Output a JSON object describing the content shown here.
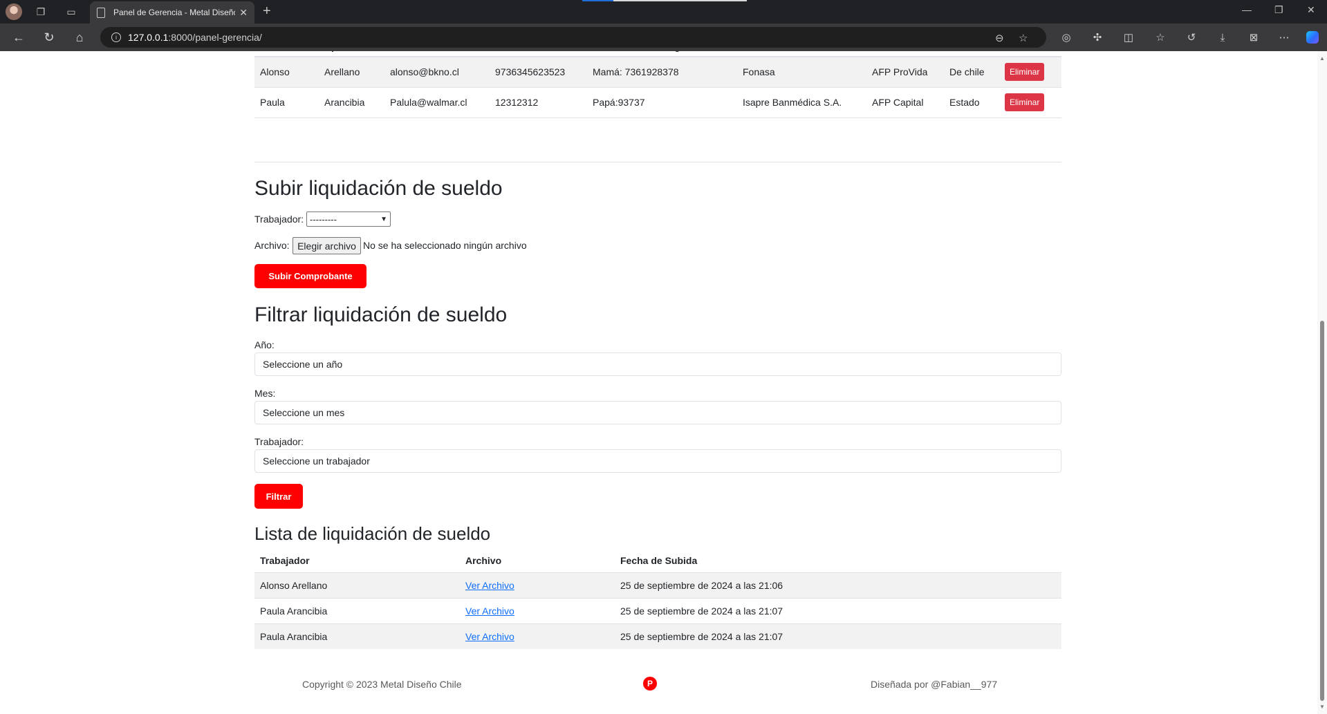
{
  "browser": {
    "tab_title": "Panel de Gerencia - Metal Diseño",
    "tab_close": "✕",
    "new_tab": "+",
    "url_host": "127.0.0.1",
    "url_rest": ":8000/panel-gerencia/"
  },
  "workers_table": {
    "headers": [
      "Nombres",
      "Apellidos",
      "Correo",
      "Teléfono",
      "Contacto de emergencia",
      "Afiliación",
      "AFP",
      "Banco",
      "Acciones"
    ],
    "rows": [
      [
        "Alonso",
        "Arellano",
        "alonso@bkno.cl",
        "9736345623523",
        "Mamá: 7361928378",
        "Fonasa",
        "AFP ProVida",
        "De chile"
      ],
      [
        "Paula",
        "Arancibia",
        "Palula@walmar.cl",
        "12312312",
        "Papá:93737",
        "Isapre Banmédica S.A.",
        "AFP Capital",
        "Estado"
      ]
    ],
    "delete_label": "Eliminar"
  },
  "upload": {
    "title": "Subir liquidación de sueldo",
    "worker_label": "Trabajador:",
    "worker_select_value": "---------",
    "file_label": "Archivo:",
    "file_button": "Elegir archivo",
    "file_status": "No se ha seleccionado ningún archivo",
    "submit": "Subir Comprobante"
  },
  "filter": {
    "title": "Filtrar liquidación de sueldo",
    "year_label": "Año:",
    "year_value": "Seleccione un año",
    "month_label": "Mes:",
    "month_value": "Seleccione un mes",
    "worker_label": "Trabajador:",
    "worker_value": "Seleccione un trabajador",
    "submit": "Filtrar"
  },
  "list": {
    "title": "Lista de liquidación de sueldo",
    "headers": [
      "Trabajador",
      "Archivo",
      "Fecha de Subida"
    ],
    "rows": [
      [
        "Alonso Arellano",
        "Ver Archivo",
        "25 de septiembre de 2024 a las 21:06"
      ],
      [
        "Paula Arancibia",
        "Ver Archivo",
        "25 de septiembre de 2024 a las 21:07"
      ],
      [
        "Paula Arancibia",
        "Ver Archivo",
        "25 de septiembre de 2024 a las 21:07"
      ]
    ]
  },
  "footer": {
    "copyright": "Copyright © 2023 Metal Diseño Chile",
    "credit": "Diseñada por @Fabian__977"
  },
  "colors": {
    "accent": "#ff0000",
    "danger": "#dc3545",
    "link": "#0d6efd"
  }
}
